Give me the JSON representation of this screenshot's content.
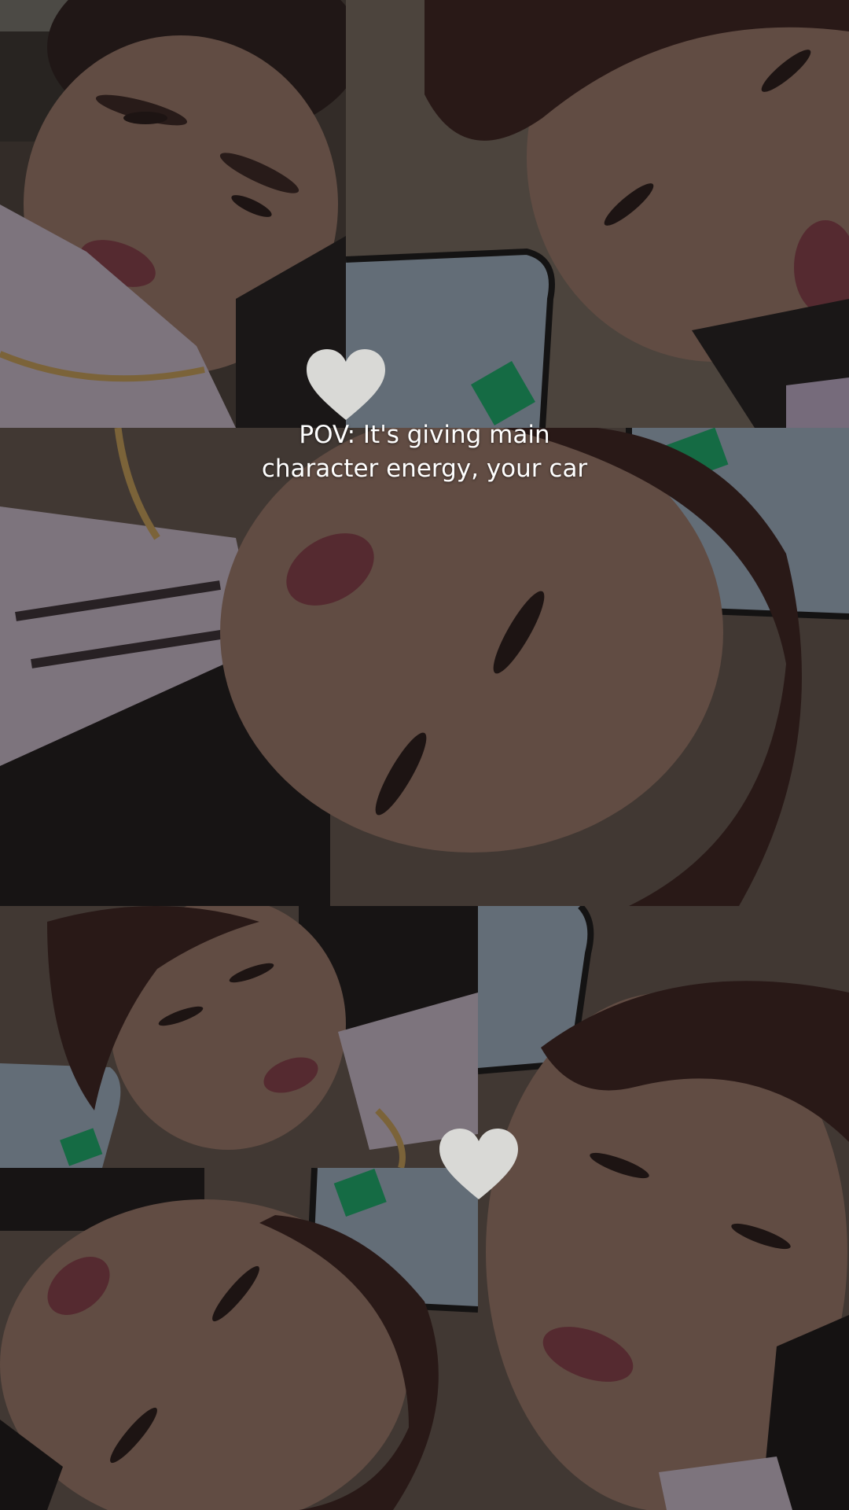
{
  "caption": {
    "line1": "POV: It's giving main",
    "line2": "character energy, your car"
  },
  "decorations": {
    "heart_icon": "white-heart-icon",
    "heart_color": "#d9d9d6"
  },
  "palette": {
    "skin": "#8a6a5e",
    "hair": "#3b2422",
    "lips": "#7a3b45",
    "scarf": "#b8a9b8",
    "car_interior": "#5e5149",
    "window": "#8f9cab",
    "sign": "#1f9a62"
  }
}
